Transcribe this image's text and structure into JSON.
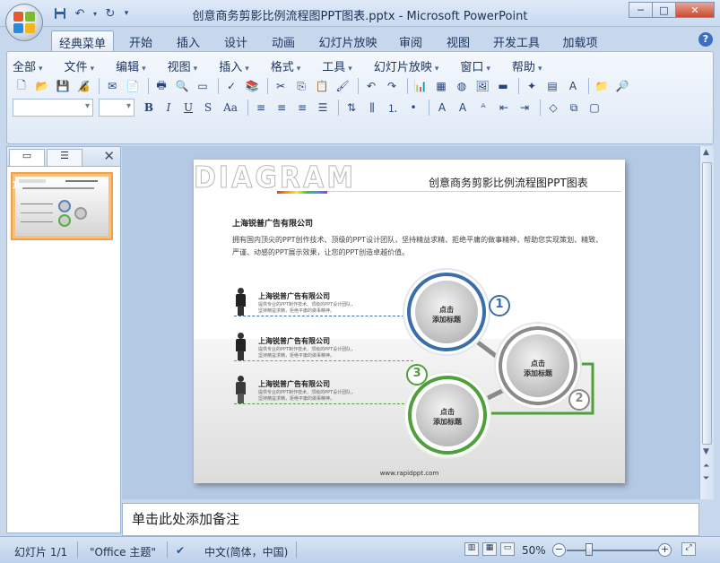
{
  "window": {
    "title": "创意商务剪影比例流程图PPT图表.pptx - Microsoft PowerPoint",
    "minimize": "─",
    "maximize": "□",
    "close": "✕"
  },
  "qat": [
    "save-icon",
    "undo-icon",
    "redo-icon",
    "customize-icon"
  ],
  "ribbon_tabs": [
    {
      "label": "经典菜单",
      "active": true
    },
    {
      "label": "开始"
    },
    {
      "label": "插入"
    },
    {
      "label": "设计"
    },
    {
      "label": "动画"
    },
    {
      "label": "幻灯片放映"
    },
    {
      "label": "审阅"
    },
    {
      "label": "视图"
    },
    {
      "label": "开发工具"
    },
    {
      "label": "加载项"
    }
  ],
  "help": "?",
  "menus": [
    "全部",
    "文件",
    "编辑",
    "视图",
    "插入",
    "格式",
    "工具",
    "幻灯片放映",
    "窗口",
    "帮助"
  ],
  "format_buttons": [
    "B",
    "I",
    "U",
    "S",
    "Aa"
  ],
  "left_panel": {
    "slide_number": "1",
    "close": "✕"
  },
  "slide": {
    "diagram_word": "DIAGRAM",
    "title": "创意商务剪影比例流程图PPT图表",
    "company": "上海锐普广告有限公司",
    "description": "拥有国内顶尖的PPT创作技术、顶级的PPT设计团队，坚持精益求精、拒绝平庸的做事精神，帮助您实现策划、精致、严谨、动感的PPT展示效果，让您的PPT创造卓越价值。",
    "rows": [
      {
        "title": "上海锐普广告有限公司",
        "text1": "提供专业的PPT制作技术、顶级的PPT设计团队，",
        "text2": "坚持精益求精，拒绝平庸的做事精神。",
        "color": "#3a6ea8"
      },
      {
        "title": "上海锐普广告有限公司",
        "text1": "提供专业的PPT制作技术、顶级的PPT设计团队，",
        "text2": "坚持精益求精，拒绝平庸的做事精神。",
        "color": "#8a8a8a"
      },
      {
        "title": "上海锐普广告有限公司",
        "text1": "提供专业的PPT制作技术、顶级的PPT设计团队，",
        "text2": "坚持精益求精，拒绝平庸的做事精神。",
        "color": "#4fa03c"
      }
    ],
    "circles": [
      {
        "line1": "点击",
        "line2": "添加标题",
        "number": "1",
        "color": "#3a6ea8"
      },
      {
        "line1": "点击",
        "line2": "添加标题",
        "number": "2",
        "color": "#8a8a8a"
      },
      {
        "line1": "点击",
        "line2": "添加标题",
        "number": "3",
        "color": "#4fa03c"
      }
    ],
    "url": "www.rapidppt.com"
  },
  "notes_placeholder": "单击此处添加备注",
  "status": {
    "slide_info": "幻灯片 1/1",
    "theme": "\"Office 主题\"",
    "language": "中文(简体，中国)",
    "zoom": "50%",
    "zoom_out": "−",
    "zoom_in": "+"
  }
}
